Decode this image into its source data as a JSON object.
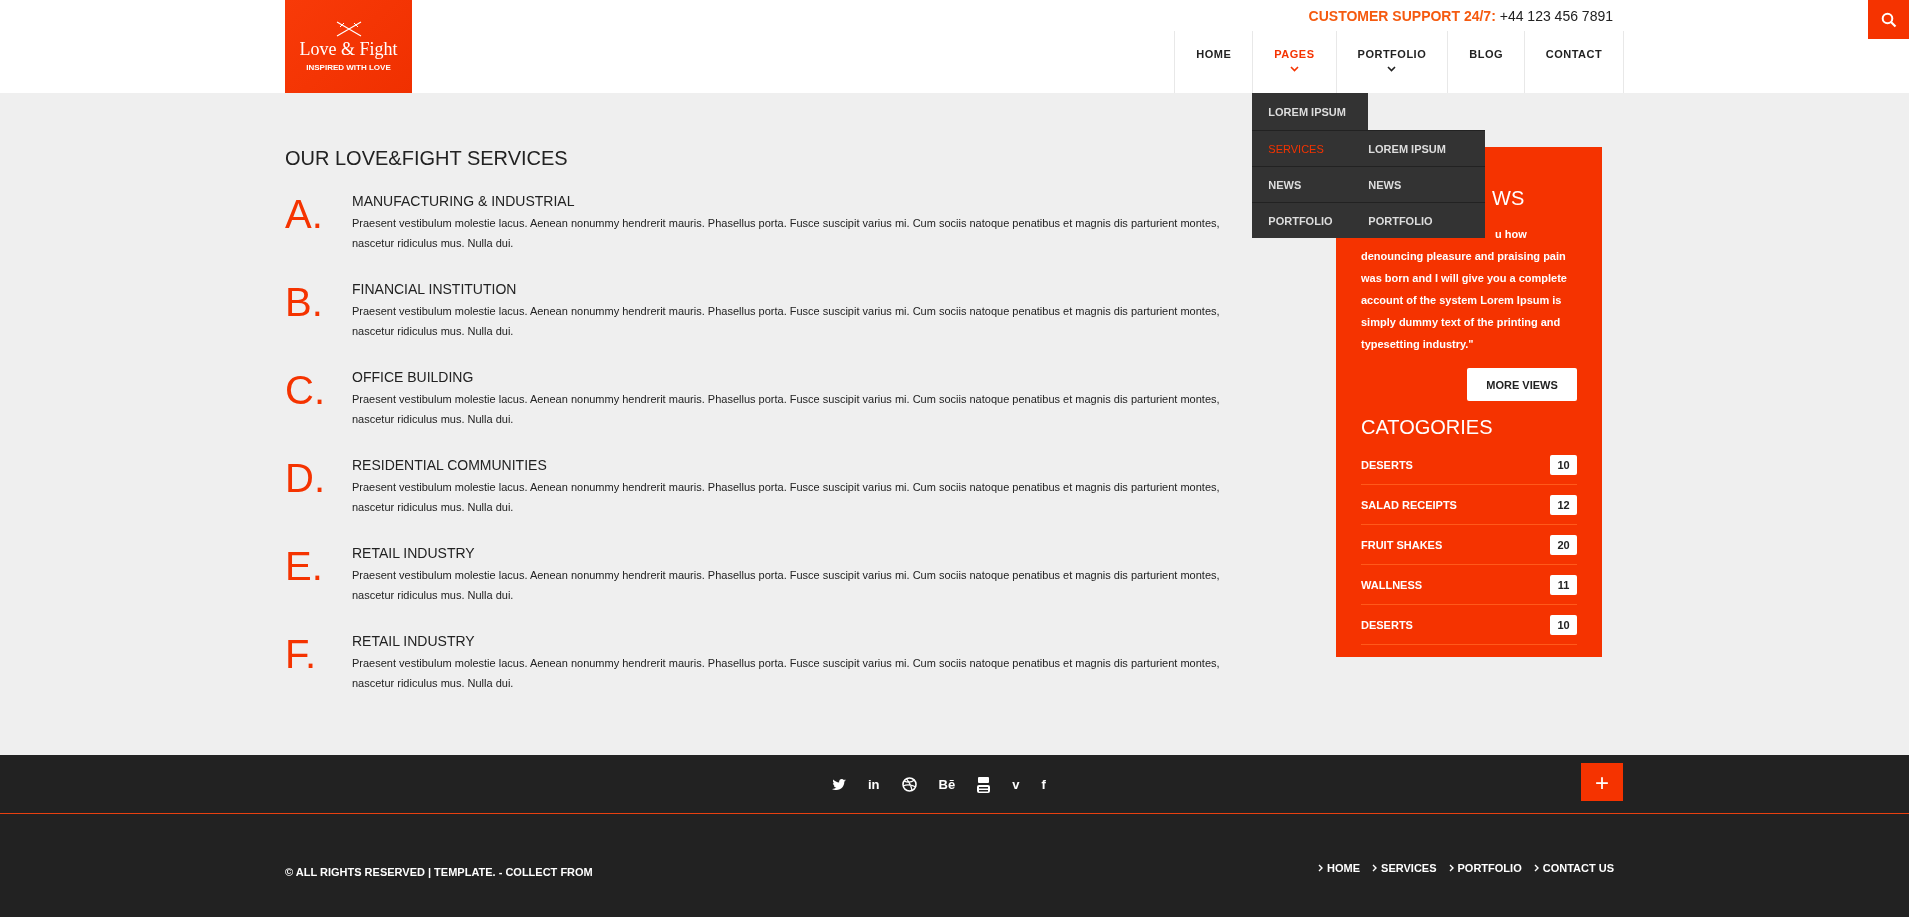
{
  "header": {
    "logo": {
      "title": "Love & Fight",
      "tagline": "INSPIRED WITH LOVE"
    },
    "support": {
      "label": "CUSTOMER SUPPORT 24/7:",
      "phone": "+44 123 456 7891"
    },
    "nav": [
      {
        "label": "HOME",
        "selected": false,
        "has_submenu": false
      },
      {
        "label": "PAGES",
        "selected": true,
        "has_submenu": true
      },
      {
        "label": "PORTFOLIO",
        "selected": false,
        "has_submenu": true
      },
      {
        "label": "BLOG",
        "selected": false,
        "has_submenu": false
      },
      {
        "label": "CONTACT",
        "selected": false,
        "has_submenu": false
      }
    ]
  },
  "dropdown": {
    "items": [
      {
        "label": "LOREM IPSUM",
        "selected": false
      },
      {
        "label": "SERVICES",
        "selected": true
      },
      {
        "label": "NEWS",
        "selected": false
      },
      {
        "label": "PORTFOLIO",
        "selected": false
      }
    ],
    "submenu": [
      {
        "label": "LOREM IPSUM"
      },
      {
        "label": "NEWS"
      },
      {
        "label": "PORTFOLIO"
      }
    ]
  },
  "services": {
    "title": "OUR LOVE&FIGHT SERVICES",
    "items": [
      {
        "letter": "A.",
        "title": "MANUFACTURING & INDUSTRIAL",
        "text": "Praesent vestibulum molestie lacus. Aenean nonummy hendrerit mauris. Phasellus porta. Fusce suscipit varius mi. Cum sociis natoque penatibus et magnis dis parturient montes, nascetur ridiculus mus. Nulla dui."
      },
      {
        "letter": "B.",
        "title": "FINANCIAL INSTITUTION",
        "text": "Praesent vestibulum molestie lacus. Aenean nonummy hendrerit mauris. Phasellus porta. Fusce suscipit varius mi. Cum sociis natoque penatibus et magnis dis parturient montes, nascetur ridiculus mus. Nulla dui."
      },
      {
        "letter": "C.",
        "title": "OFFICE BUILDING",
        "text": "Praesent vestibulum molestie lacus. Aenean nonummy hendrerit mauris. Phasellus porta. Fusce suscipit varius mi. Cum sociis natoque penatibus et magnis dis parturient montes, nascetur ridiculus mus. Nulla dui."
      },
      {
        "letter": "D.",
        "title": "RESIDENTIAL COMMUNITIES",
        "text": "Praesent vestibulum molestie lacus. Aenean nonummy hendrerit mauris. Phasellus porta. Fusce suscipit varius mi. Cum sociis natoque penatibus et magnis dis parturient montes, nascetur ridiculus mus. Nulla dui."
      },
      {
        "letter": "E.",
        "title": "RETAIL INDUSTRY",
        "text": "Praesent vestibulum molestie lacus. Aenean nonummy hendrerit mauris. Phasellus porta. Fusce suscipit varius mi. Cum sociis natoque penatibus et magnis dis parturient montes, nascetur ridiculus mus. Nulla dui."
      },
      {
        "letter": "F.",
        "title": "RETAIL INDUSTRY",
        "text": "Praesent vestibulum molestie lacus. Aenean nonummy hendrerit mauris. Phasellus porta. Fusce suscipit varius mi. Cum sociis natoque penatibus et magnis dis parturient montes, nascetur ridiculus mus. Nulla dui."
      }
    ]
  },
  "sidebar": {
    "heading": "WS",
    "quote_first_line": "u how",
    "quote": "denouncing pleasure and praising pain was born and I will give you a complete account of the system Lorem Ipsum is simply dummy text of the printing and typesetting industry.\"",
    "button": "MORE VIEWS",
    "categories_title": "CATOGORIES",
    "categories": [
      {
        "name": "DESERTS",
        "count": "10"
      },
      {
        "name": "SALAD RECEIPTS",
        "count": "12"
      },
      {
        "name": "FRUIT SHAKES",
        "count": "20"
      },
      {
        "name": "WALLNESS",
        "count": "11"
      },
      {
        "name": "DESERTS",
        "count": "10"
      }
    ]
  },
  "footer": {
    "social": [
      {
        "kind": "twitter"
      },
      {
        "kind": "text",
        "glyph": "in"
      },
      {
        "kind": "dribbble"
      },
      {
        "kind": "text",
        "glyph": "Bē"
      },
      {
        "kind": "youtube"
      },
      {
        "kind": "text",
        "glyph": "v"
      },
      {
        "kind": "text",
        "glyph": "f"
      }
    ],
    "plus": "+",
    "copyright": "© ALL RIGHTS RESERVED | TEMPLATE. - COLLECT FROM",
    "links": [
      "HOME",
      "SERVICES",
      "PORTFOLIO",
      "CONTACT US"
    ]
  }
}
